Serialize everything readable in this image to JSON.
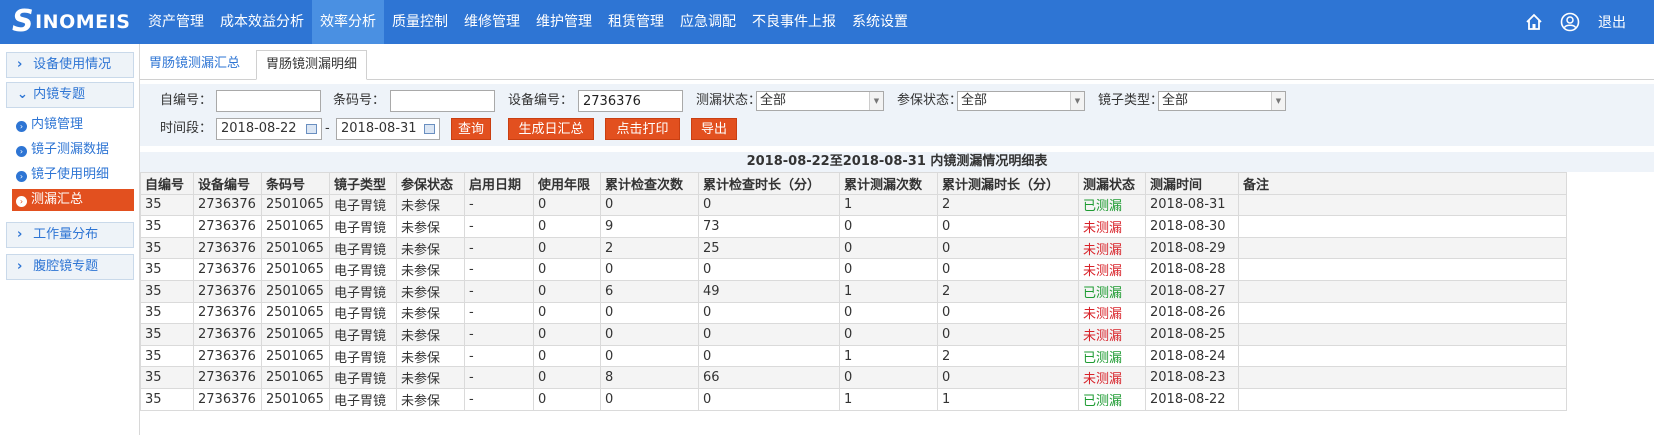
{
  "brand": {
    "name": "SINOMEIS"
  },
  "nav": {
    "items": [
      "资产管理",
      "成本效益分析",
      "效率分析",
      "质量控制",
      "维修管理",
      "维护管理",
      "租赁管理",
      "应急调配",
      "不良事件上报",
      "系统设置"
    ],
    "active_index": 2
  },
  "header": {
    "logout": "退出",
    "home_icon": "home-icon",
    "user_icon": "user-icon"
  },
  "sidebar": {
    "group1": "设备使用情况",
    "group2": "内镜专题",
    "sub": [
      "内镜管理",
      "镜子测漏数据",
      "镜子使用明细",
      "测漏汇总"
    ],
    "active_sub": 3,
    "group3": "工作量分布",
    "group4": "腹腔镜专题"
  },
  "tabs": {
    "t1": "胃肠镜测漏汇总",
    "t2": "胃肠镜测漏明细"
  },
  "filter": {
    "self_no_label": "自编号：",
    "self_no_value": "",
    "barcode_label": "条码号：",
    "barcode_value": "",
    "device_no_label": "设备编号：",
    "device_no_value": "2736376",
    "leak_status_label": "测漏状态：",
    "leak_status_value": "全部",
    "warranty_label": "参保状态：",
    "warranty_value": "全部",
    "scope_type_label": "镜子类型：",
    "scope_type_value": "全部",
    "period_label": "时间段：",
    "date_from": "2018-08-22",
    "date_sep": "-",
    "date_to": "2018-08-31",
    "btn_query": "查询",
    "btn_daily": "生成日汇总",
    "btn_print": "点击打印",
    "btn_export": "导出"
  },
  "table": {
    "title": "2018-08-22至2018-08-31 内镜测漏情况明细表",
    "columns": [
      "自编号",
      "设备编号",
      "条码号",
      "镜子类型",
      "参保状态",
      "启用日期",
      "使用年限",
      "累计检查次数",
      "累计检查时长（分）",
      "累计测漏次数",
      "累计测漏时长（分）",
      "测漏状态",
      "测漏时间",
      "备注"
    ],
    "rows": [
      [
        "35",
        "2736376",
        "2501065",
        "电子胃镜",
        "未参保",
        "-",
        "0",
        "0",
        "0",
        "1",
        "2",
        "已测漏",
        "2018-08-31",
        ""
      ],
      [
        "35",
        "2736376",
        "2501065",
        "电子胃镜",
        "未参保",
        "-",
        "0",
        "9",
        "73",
        "0",
        "0",
        "未测漏",
        "2018-08-30",
        ""
      ],
      [
        "35",
        "2736376",
        "2501065",
        "电子胃镜",
        "未参保",
        "-",
        "0",
        "2",
        "25",
        "0",
        "0",
        "未测漏",
        "2018-08-29",
        ""
      ],
      [
        "35",
        "2736376",
        "2501065",
        "电子胃镜",
        "未参保",
        "-",
        "0",
        "0",
        "0",
        "0",
        "0",
        "未测漏",
        "2018-08-28",
        ""
      ],
      [
        "35",
        "2736376",
        "2501065",
        "电子胃镜",
        "未参保",
        "-",
        "0",
        "6",
        "49",
        "1",
        "2",
        "已测漏",
        "2018-08-27",
        ""
      ],
      [
        "35",
        "2736376",
        "2501065",
        "电子胃镜",
        "未参保",
        "-",
        "0",
        "0",
        "0",
        "0",
        "0",
        "未测漏",
        "2018-08-26",
        ""
      ],
      [
        "35",
        "2736376",
        "2501065",
        "电子胃镜",
        "未参保",
        "-",
        "0",
        "0",
        "0",
        "0",
        "0",
        "未测漏",
        "2018-08-25",
        ""
      ],
      [
        "35",
        "2736376",
        "2501065",
        "电子胃镜",
        "未参保",
        "-",
        "0",
        "0",
        "0",
        "1",
        "2",
        "已测漏",
        "2018-08-24",
        ""
      ],
      [
        "35",
        "2736376",
        "2501065",
        "电子胃镜",
        "未参保",
        "-",
        "0",
        "8",
        "66",
        "0",
        "0",
        "未测漏",
        "2018-08-23",
        ""
      ],
      [
        "35",
        "2736376",
        "2501065",
        "电子胃镜",
        "未参保",
        "-",
        "0",
        "0",
        "0",
        "1",
        "1",
        "已测漏",
        "2018-08-22",
        ""
      ]
    ]
  },
  "colors": {
    "nav_bg": "#2e75d4",
    "accent": "#e2501f",
    "done": "#1e9b32",
    "none": "#d8232a"
  }
}
